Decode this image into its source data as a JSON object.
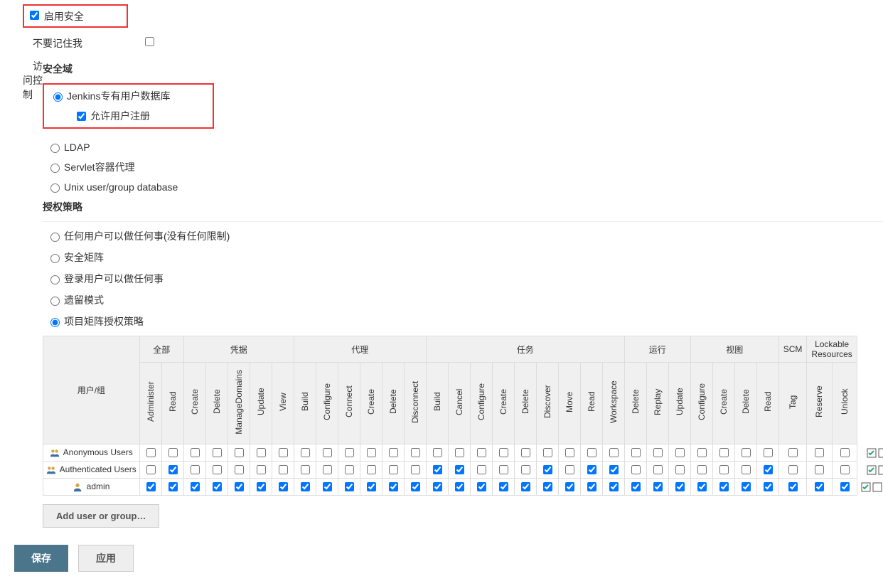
{
  "labels": {
    "enable_security": "启用安全",
    "dont_remember_me": "不要记住我",
    "access_control": "访问控制",
    "security_realm_title": "安全域",
    "auth_strategy_title": "授权策略",
    "add_user_or_group": "Add user or group…",
    "save": "保存",
    "apply": "应用"
  },
  "security_realm": {
    "options": [
      {
        "id": "jenkins_db",
        "label": "Jenkins专有用户数据库",
        "checked": true,
        "allow_signup_label": "允许用户注册",
        "allow_signup_checked": true
      },
      {
        "id": "ldap",
        "label": "LDAP",
        "checked": false
      },
      {
        "id": "servlet",
        "label": "Servlet容器代理",
        "checked": false
      },
      {
        "id": "unix",
        "label": "Unix user/group database",
        "checked": false
      }
    ]
  },
  "auth_strategy": {
    "options": [
      {
        "id": "anyone",
        "label": "任何用户可以做任何事(没有任何限制)",
        "checked": false
      },
      {
        "id": "matrix",
        "label": "安全矩阵",
        "checked": false
      },
      {
        "id": "logged_in",
        "label": "登录用户可以做任何事",
        "checked": false
      },
      {
        "id": "legacy",
        "label": "遗留模式",
        "checked": false
      },
      {
        "id": "project_matrix",
        "label": "项目矩阵授权策略",
        "checked": true
      }
    ]
  },
  "matrix": {
    "user_group_header": "用户/组",
    "groups": [
      {
        "label": "全部",
        "perms": [
          "Administer",
          "Read"
        ]
      },
      {
        "label": "凭据",
        "perms": [
          "Create",
          "Delete",
          "ManageDomains",
          "Update",
          "View"
        ]
      },
      {
        "label": "代理",
        "perms": [
          "Build",
          "Configure",
          "Connect",
          "Create",
          "Delete",
          "Disconnect"
        ]
      },
      {
        "label": "任务",
        "perms": [
          "Build",
          "Cancel",
          "Configure",
          "Create",
          "Delete",
          "Discover",
          "Move",
          "Read",
          "Workspace"
        ]
      },
      {
        "label": "运行",
        "perms": [
          "Delete",
          "Replay",
          "Update"
        ]
      },
      {
        "label": "视图",
        "perms": [
          "Configure",
          "Create",
          "Delete",
          "Read"
        ]
      },
      {
        "label": "SCM",
        "perms": [
          "Tag"
        ]
      },
      {
        "label": "Lockable Resources",
        "perms": [
          "Reserve",
          "Unlock"
        ]
      }
    ],
    "rows": [
      {
        "name": "Anonymous Users",
        "icon": "group",
        "checked": [
          false,
          false,
          false,
          false,
          false,
          false,
          false,
          false,
          false,
          false,
          false,
          false,
          false,
          false,
          false,
          false,
          false,
          false,
          false,
          false,
          false,
          false,
          false,
          false,
          false,
          false,
          false,
          false,
          false,
          false,
          false,
          false
        ],
        "actions": [
          "check-all",
          "uncheck-all"
        ]
      },
      {
        "name": "Authenticated Users",
        "icon": "group",
        "checked": [
          false,
          true,
          false,
          false,
          false,
          false,
          false,
          false,
          false,
          false,
          false,
          false,
          false,
          true,
          true,
          false,
          false,
          false,
          true,
          false,
          true,
          true,
          false,
          false,
          false,
          false,
          false,
          false,
          true,
          false,
          false,
          false
        ],
        "actions": [
          "check-all",
          "uncheck-all"
        ]
      },
      {
        "name": "admin",
        "icon": "user",
        "checked": [
          true,
          true,
          true,
          true,
          true,
          true,
          true,
          true,
          true,
          true,
          true,
          true,
          true,
          true,
          true,
          true,
          true,
          true,
          true,
          true,
          true,
          true,
          true,
          true,
          true,
          true,
          true,
          true,
          true,
          true,
          true,
          true
        ],
        "actions": [
          "check-all",
          "uncheck-all",
          "delete"
        ]
      }
    ]
  },
  "enable_security_checked": true,
  "dont_remember_me_checked": false
}
